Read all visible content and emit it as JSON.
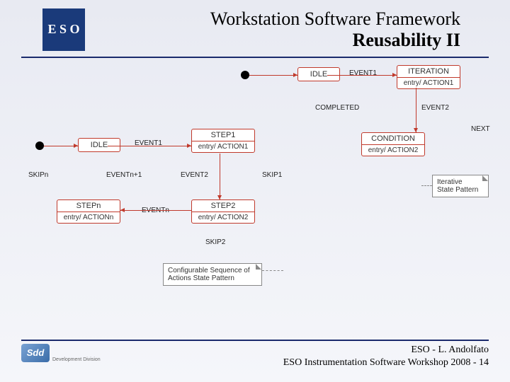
{
  "header": {
    "logo_text": "E S\nO",
    "title_line1": "Workstation Software Framework",
    "title_line2": "Reusability II"
  },
  "diagram": {
    "top_left_state": "IDLE",
    "top_left_event": "EVENT1",
    "iteration_state": "ITERATION",
    "iteration_entry": "entry/ ACTION1",
    "completed": "COMPLETED",
    "event2": "EVENT2",
    "next": "NEXT",
    "idle2": "IDLE",
    "event1": "EVENT1",
    "step1": "STEP1",
    "step1_entry": "entry/ ACTION1",
    "condition": "CONDITION",
    "condition_entry": "entry/ ACTION2",
    "skipn": "SKIPn",
    "eventn1": "EVENTn+1",
    "event12": "EVENT2",
    "skip1": "SKIP1",
    "stepn": "STEPn",
    "stepn_entry": "entry/ ACTIONn",
    "eventn": "EVENTn",
    "step2": "STEP2",
    "step2_entry": "entry/ ACTION2",
    "skip2": "SKIP2",
    "note_left": "Configurable Sequence of\nActions State Pattern",
    "note_right": "Iterative\nState Pattern"
  },
  "footer": {
    "sdd_label": "Sdd",
    "sdd_sub": "Development Division",
    "line1": "ESO - L. Andolfato",
    "line2": "ESO Instrumentation Software Workshop 2008 - 14"
  }
}
